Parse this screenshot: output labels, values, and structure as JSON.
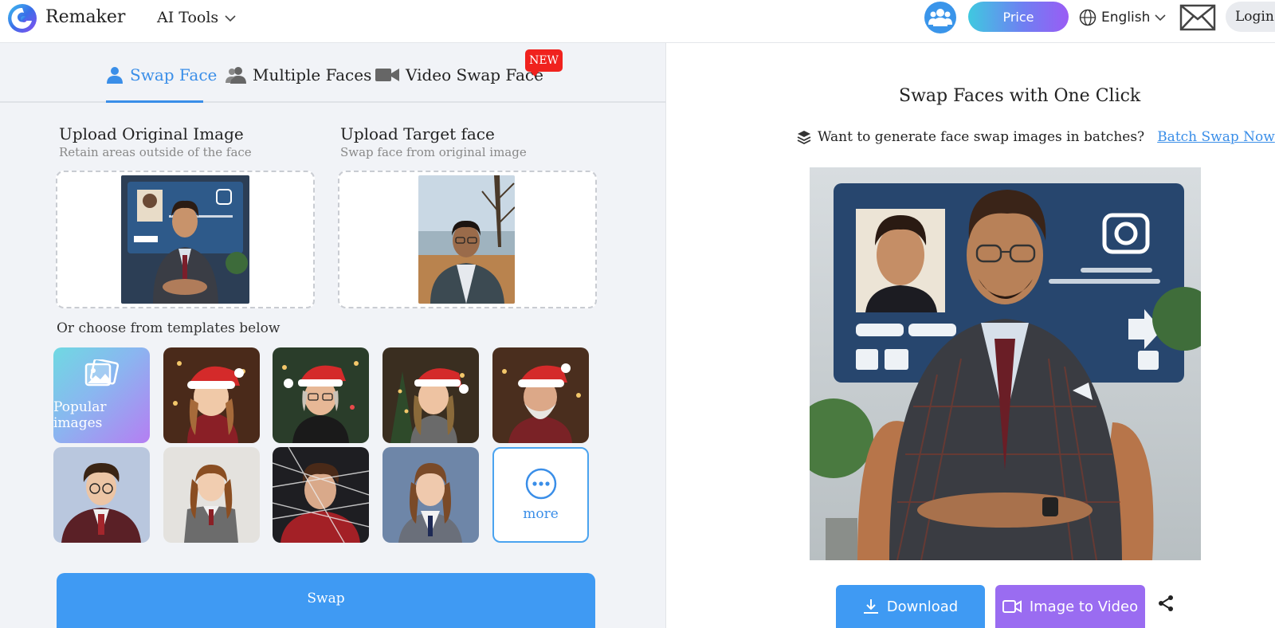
{
  "header": {
    "brand": "Remaker",
    "ai_tools_label": "AI Tools",
    "price_label": "Price",
    "language_label": "English",
    "login_label": "Login"
  },
  "tabs": [
    {
      "label": "Swap Face",
      "icon": "user-icon",
      "active": true
    },
    {
      "label": "Multiple Faces",
      "icon": "users-icon",
      "active": false
    },
    {
      "label": "Video Swap Face",
      "icon": "video-camera-icon",
      "active": false
    }
  ],
  "new_badge": "NEW",
  "upload": {
    "original_title": "Upload Original Image",
    "original_subtitle": "Retain areas outside of the face",
    "target_title": "Upload Target face",
    "target_subtitle": "Swap face from original image"
  },
  "templates": {
    "label": "Or choose from templates below",
    "popular_label": "Popular images",
    "more_label": "more"
  },
  "swap_label": "Swap",
  "result": {
    "title": "Swap Faces with One Click",
    "batch_text": "Want to generate face swap images in batches?",
    "batch_link": "Batch Swap Now",
    "download_label": "Download",
    "image_to_video_label": "Image to Video"
  },
  "colors": {
    "accent_blue": "#3a8ee8",
    "button_blue": "#3f9af3",
    "video_purple": "#9a6cf1",
    "new_red": "#f0221e",
    "panel_bg": "#f1f3f7"
  }
}
